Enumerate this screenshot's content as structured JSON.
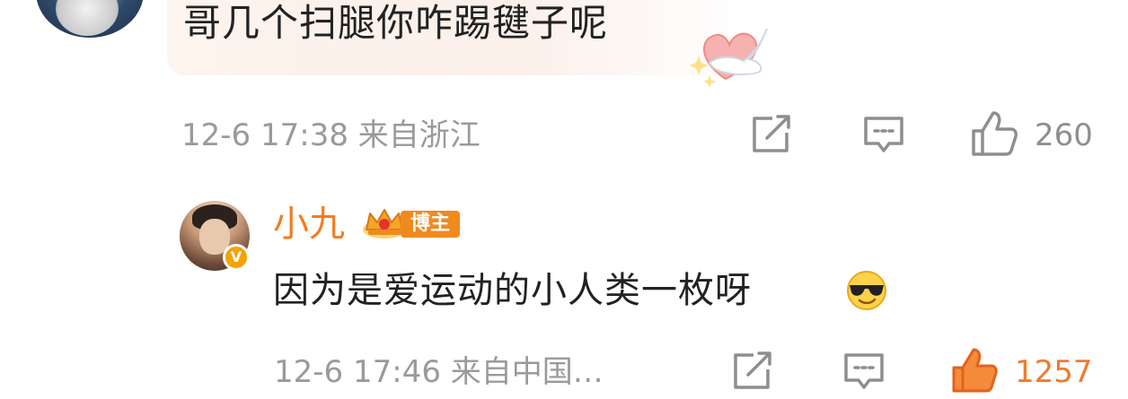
{
  "comment": {
    "text": "哥几个扫腿你咋踢毽子呢",
    "meta": "12-6 17:38 来自浙江",
    "like_count": "260",
    "icons": [
      "share-icon",
      "reply-icon",
      "like-icon"
    ]
  },
  "reply": {
    "author": "小九",
    "badge_label": "博主",
    "text": "因为是爱运动的小人类一枚呀",
    "emoji": "cool-sunglasses-emoji",
    "meta": "12-6 17:46 来自中国…",
    "like_count": "1257",
    "liked": true,
    "accent_color": "#f27d21"
  }
}
